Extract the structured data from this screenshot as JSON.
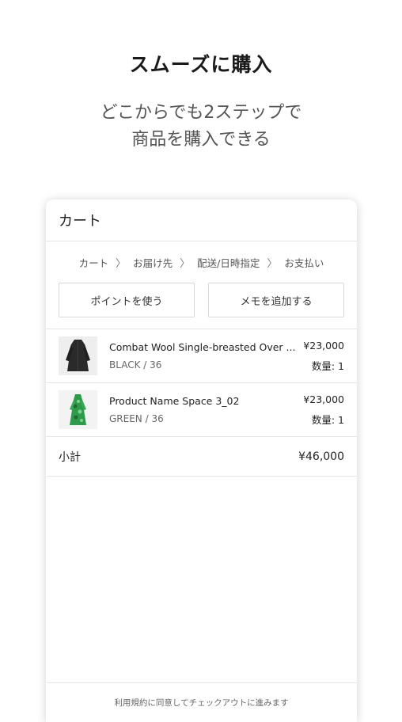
{
  "promo": {
    "title": "スムーズに購入",
    "subtitle_line1": "どこからでも2ステップで",
    "subtitle_line2": "商品を購入できる"
  },
  "cart": {
    "header_title": "カート",
    "steps": [
      "カート",
      "お届け先",
      "配送/日時指定",
      "お支払い"
    ],
    "step_separator": "〉",
    "use_points_label": "ポイントを使う",
    "add_memo_label": "メモを追加する",
    "items": [
      {
        "name": "Combat Wool Single-breasted Over ...",
        "variant": "BLACK / 36",
        "price": "¥23,000",
        "qty": "数量: 1",
        "thumb_icon": "black-coat-thumbnail"
      },
      {
        "name": "Product Name Space 3_02",
        "variant": "GREEN / 36",
        "price": "¥23,000",
        "qty": "数量: 1",
        "thumb_icon": "green-dress-thumbnail"
      }
    ],
    "subtotal_label": "小計",
    "subtotal_value": "¥46,000",
    "footer_note": "利用規約に同意してチェックアウトに進みます"
  }
}
